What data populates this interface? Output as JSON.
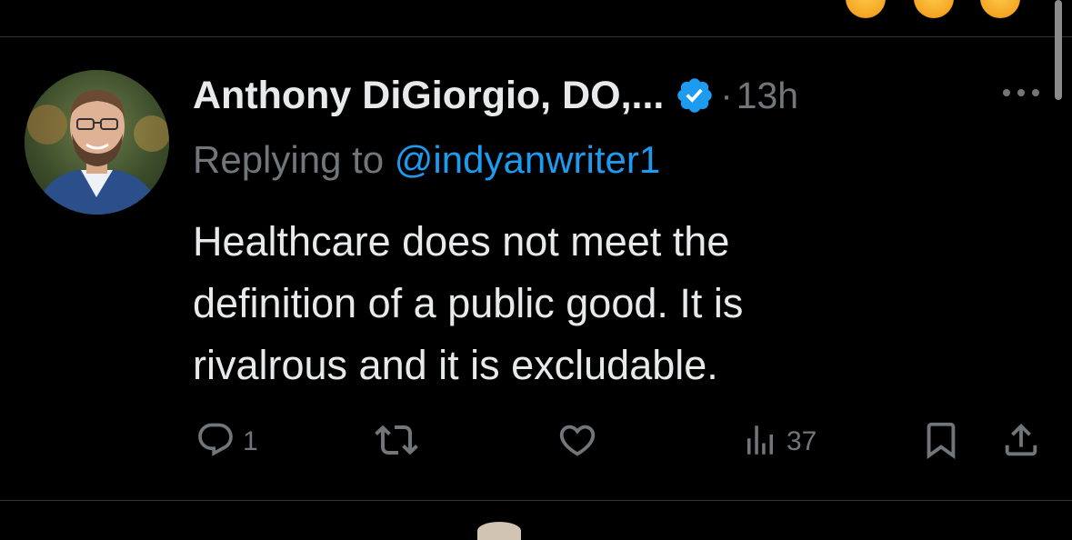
{
  "tweet": {
    "author_name": "Anthony DiGiorgio, DO,...",
    "separator": "·",
    "timestamp": "13h",
    "replying_prefix": "Replying to ",
    "replying_handle": "@indyanwriter1",
    "text": "Healthcare does not meet the\ndefinition of a public good. It is\nrivalrous and it is excludable.",
    "reply_count": "1",
    "view_count": "37"
  },
  "icons": {
    "verified": "verified-badge-icon",
    "more": "more-options-icon",
    "reply": "reply-icon",
    "retweet": "retweet-icon",
    "like": "like-icon",
    "views": "views-icon",
    "bookmark": "bookmark-icon",
    "share": "share-icon"
  },
  "colors": {
    "background": "#000000",
    "text": "#e7e9ea",
    "secondary": "#71767b",
    "accent": "#1d9bf0",
    "divider": "#2f3336"
  }
}
